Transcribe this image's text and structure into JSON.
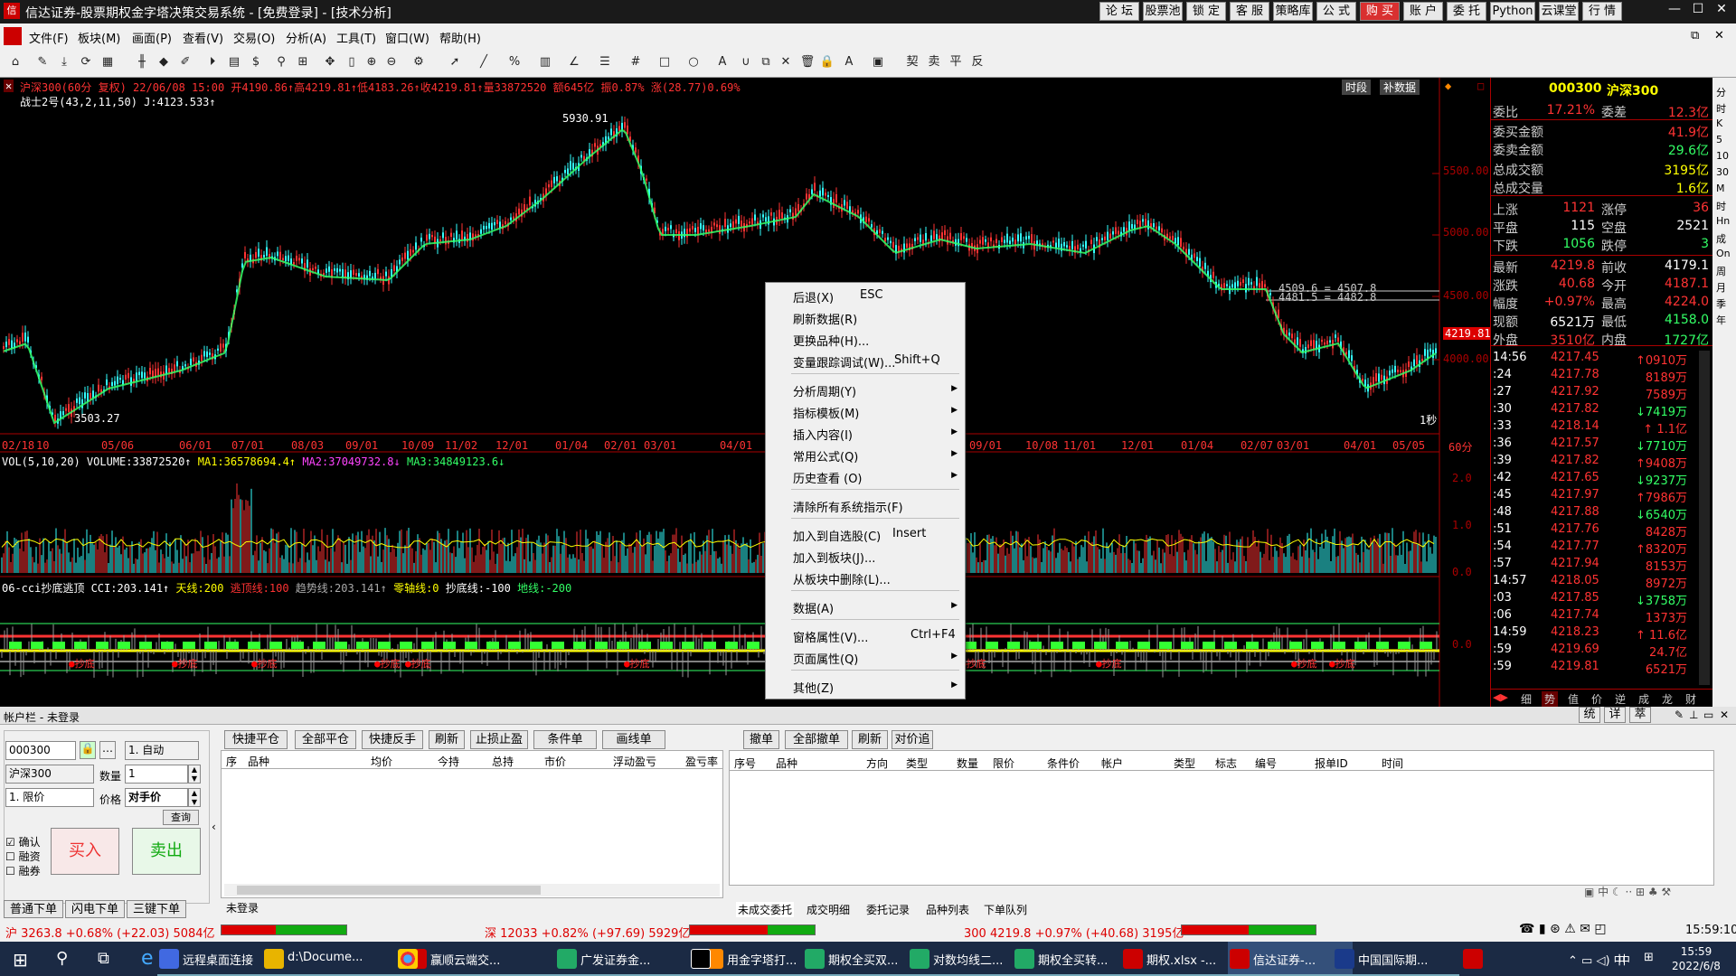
{
  "window": {
    "title": "信达证券-股票期权金字塔决策交易系统 - [免费登录] - [技术分析]",
    "top_buttons": [
      "论 坛",
      "股票池",
      "锁 定",
      "客 服",
      "策略库",
      "公 式",
      "购 买",
      "账 户",
      "委 托",
      "Python",
      "云课堂",
      "行 情"
    ]
  },
  "menu": [
    "文件(F)",
    "板块(M)",
    "画面(P)",
    "查看(V)",
    "交易(O)",
    "分析(A)",
    "工具(T)",
    "窗口(W)",
    "帮助(H)"
  ],
  "chart": {
    "header": "沪深300(60分 复权) 22/06/08 15:00 开4190.86↑高4219.81↑低4183.26↑收4219.81↑量33872520 额645亿 振0.87% 涨(28.77)0.69%",
    "indicator1": "战士2号(43,2,11,50) J:4123.533↑",
    "buttons": [
      "时段",
      "补数据"
    ],
    "price_labels": [
      "5500.00",
      "5000.00",
      "4500.00",
      "4000.00"
    ],
    "high_label": "5930.91",
    "low_label": "3503.27",
    "current_price": "4219.81",
    "hline_label": "4509.6 = 4507.8",
    "hline_label2": "4481.5 = 4482.8",
    "date_ticks": [
      "02/18",
      "10",
      "05/06",
      "06/01",
      "07/01",
      "08/03",
      "09/01",
      "10/09",
      "11/02",
      "12/01",
      "01/04",
      "02/01",
      "03/01",
      "04/01",
      "09/01",
      "10/08",
      "11/01",
      "12/01",
      "01/04",
      "02/07",
      "03/01",
      "04/01",
      "05/05"
    ],
    "period": "60分",
    "sec_label": "1秒",
    "vol_header_parts": [
      "VOL(5,10,20) VOLUME:33872520↑",
      "MA1:36578694.4↑",
      "MA2:37049732.8↓",
      "MA3:34849123.6↓"
    ],
    "vol_labels": [
      "2.0",
      "1.0",
      "0.0"
    ],
    "cci_header_parts": [
      "06-cci抄底逃顶 CCI:203.141↑",
      "天线:200",
      "逃顶线:100",
      "趋势线:203.141↑",
      "零轴线:0",
      "抄底线:-100",
      "地线:-200"
    ],
    "cci_label": "0.0",
    "cci_markers": [
      "抄底",
      "抄底",
      "抄底",
      "抄底",
      "抄底",
      "抄底",
      "抄底",
      "抄底",
      "抄底",
      "抄底"
    ]
  },
  "context_menu": {
    "items": [
      {
        "label": "后退(X)",
        "shortcut": "ESC"
      },
      {
        "label": "刷新数据(R)"
      },
      {
        "label": "更换品种(H)..."
      },
      {
        "label": "变量跟踪调试(W)...",
        "shortcut": "Shift+Q"
      },
      {
        "label": "分析周期(Y)",
        "arrow": "▶"
      },
      {
        "label": "指标模板(M)",
        "arrow": "▶"
      },
      {
        "label": "插入内容(I)",
        "arrow": "▶"
      },
      {
        "label": "常用公式(Q)",
        "arrow": "▶"
      },
      {
        "label": "历史查看 (O)",
        "arrow": "▶"
      },
      {
        "label": "清除所有系统指示(F)"
      },
      {
        "label": "加入到自选股(C)",
        "shortcut": "Insert"
      },
      {
        "label": "加入到板块(J)..."
      },
      {
        "label": "从板块中删除(L)..."
      },
      {
        "label": "数据(A)",
        "arrow": "▶"
      },
      {
        "label": "窗格属性(V)...",
        "shortcut": "Ctrl+F4"
      },
      {
        "label": "页面属性(Q)",
        "arrow": "▶"
      },
      {
        "label": "其他(Z)",
        "arrow": "▶"
      }
    ]
  },
  "quote": {
    "code": "000300",
    "name": "沪深300",
    "rows": [
      [
        "委比",
        "17.21%",
        "委差",
        "12.3亿"
      ],
      [
        "委买金额",
        "41.9亿",
        "",
        ""
      ],
      [
        "委卖金额",
        "29.6亿",
        "",
        ""
      ],
      [
        "总成交额",
        "3195亿",
        "",
        ""
      ],
      [
        "总成交量",
        "1.6亿",
        "",
        ""
      ],
      [
        "上涨",
        "1121",
        "涨停",
        "36"
      ],
      [
        "平盘",
        "115",
        "空盘",
        "2521"
      ],
      [
        "下跌",
        "1056",
        "跌停",
        "3"
      ],
      [
        "最新",
        "4219.8",
        "前收",
        "4179.1"
      ],
      [
        "涨跌",
        "40.68",
        "今开",
        "4187.1"
      ],
      [
        "幅度",
        "+0.97%",
        "最高",
        "4224.0"
      ],
      [
        "现额",
        "6521万",
        "最低",
        "4158.0"
      ],
      [
        "外盘",
        "3510亿",
        "内盘",
        "1727亿"
      ]
    ],
    "ticks": [
      [
        "14:56",
        "4217.45",
        "↑0910万"
      ],
      [
        ":24",
        "4217.78",
        "8189万"
      ],
      [
        ":27",
        "4217.92",
        "7589万"
      ],
      [
        ":30",
        "4217.82",
        "↓7419万"
      ],
      [
        ":33",
        "4218.14",
        "↑ 1.1亿"
      ],
      [
        ":36",
        "4217.57",
        "↓7710万"
      ],
      [
        ":39",
        "4217.82",
        "↑9408万"
      ],
      [
        ":42",
        "4217.65",
        "↓9237万"
      ],
      [
        ":45",
        "4217.97",
        "↑7986万"
      ],
      [
        ":48",
        "4217.88",
        "↓6540万"
      ],
      [
        ":51",
        "4217.76",
        "8428万"
      ],
      [
        ":54",
        "4217.77",
        "↑8320万"
      ],
      [
        ":57",
        "4217.94",
        "8153万"
      ],
      [
        "14:57",
        "4218.05",
        "8972万"
      ],
      [
        ":03",
        "4217.85",
        "↓3758万"
      ],
      [
        ":06",
        "4217.74",
        "1373万"
      ],
      [
        "14:59",
        "4218.23",
        "↑ 11.6亿"
      ],
      [
        ":59",
        "4219.69",
        "24.7亿"
      ],
      [
        ":59",
        "4219.81",
        "6521万"
      ]
    ],
    "bottom_tabs": [
      "细",
      "势",
      "值",
      "价",
      "逆",
      "成",
      "龙",
      "财"
    ],
    "side_tabs": [
      "分",
      "时",
      "K",
      "5",
      "10",
      "30",
      "M",
      "时",
      "Hn",
      "成",
      "On",
      "周",
      "月",
      "季",
      "年"
    ]
  },
  "account": {
    "title": "帐户栏 - 未登录",
    "code": "000300",
    "mode": "1. 自动",
    "name": "沪深300",
    "qty_label": "数量",
    "qty": "1",
    "order_type": "1. 限价",
    "price_label": "价格",
    "price": "对手价",
    "query": "查询",
    "checks": [
      "确认",
      "融资",
      "融券"
    ],
    "buy": "买入",
    "sell": "卖出",
    "pos_buttons": [
      "快捷平仓",
      "全部平仓",
      "快捷反手",
      "刷新",
      "止损止盈",
      "条件单",
      "画线单"
    ],
    "pos_headers": [
      "序",
      "品种",
      "均价",
      "今持",
      "总持",
      "市价",
      "浮动盈亏",
      "盈亏率"
    ],
    "order_buttons": [
      "撤单",
      "全部撤单",
      "刷新",
      "对价追"
    ],
    "order_headers": [
      "序号",
      "品种",
      "方向",
      "类型",
      "数量",
      "限价",
      "条件价",
      "帐户",
      "类型",
      "标志",
      "编号",
      "报单ID",
      "时间"
    ],
    "left_tabs": [
      "普通下单",
      "闪电下单",
      "三键下单"
    ],
    "status_tab": "未登录",
    "order_tabs": [
      "未成交委托",
      "成交明细",
      "委托记录",
      "品种列表",
      "下单队列"
    ],
    "top_right": [
      "统",
      "详",
      "萃"
    ]
  },
  "statusbar": {
    "sh": "沪 3263.8 +0.68% (+22.03) 5084亿",
    "sz": "深 12033 +0.82% (+97.69) 5929亿",
    "hs300": "300 4219.8 +0.97% (+40.68) 3195亿",
    "time": "15:59:10"
  },
  "taskbar": {
    "items": [
      "远程桌面连接",
      "d:\\Docume...",
      "赢顺云端交...",
      "广发证券金...",
      "用金字塔打...",
      "期权全买双...",
      "对数均线二...",
      "期权全买转...",
      "期权.xlsx -...",
      "信达证券-...",
      "中国国际期..."
    ],
    "clock_time": "15:59",
    "clock_date": "2022/6/8",
    "ime": "中"
  },
  "colors": {
    "up": "#ff3333",
    "down": "#33ff66",
    "accent": "#ffff00"
  }
}
